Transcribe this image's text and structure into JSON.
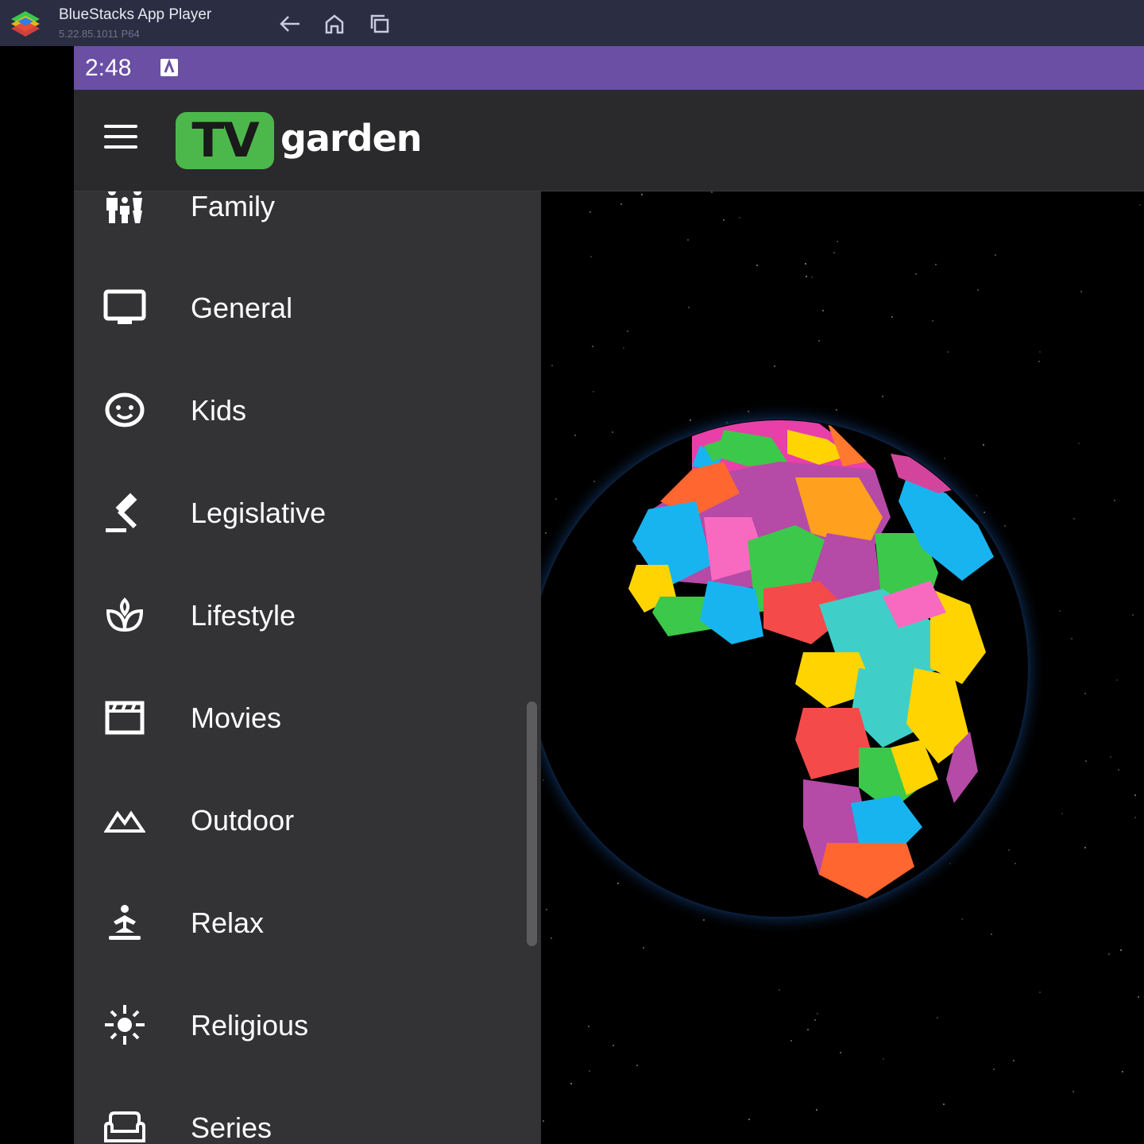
{
  "window": {
    "title": "BlueStacks App Player",
    "version": "5.22.85.1011  P64",
    "nav_icons": [
      "back-arrow-icon",
      "home-icon",
      "recent-apps-icon"
    ]
  },
  "status_bar": {
    "time": "2:48",
    "notification_icon": "app-notification-icon",
    "color": "#6a4fa5"
  },
  "app_bar": {
    "logo_badge": "TV",
    "logo_text": "garden",
    "logo_color": "#4cb84c",
    "menu_icon": "hamburger-menu-icon"
  },
  "drawer": {
    "items": [
      {
        "label": "Family",
        "icon": "family-icon"
      },
      {
        "label": "General",
        "icon": "monitor-icon"
      },
      {
        "label": "Kids",
        "icon": "baby-face-icon"
      },
      {
        "label": "Legislative",
        "icon": "gavel-icon"
      },
      {
        "label": "Lifestyle",
        "icon": "lotus-icon"
      },
      {
        "label": "Movies",
        "icon": "clapperboard-icon"
      },
      {
        "label": "Outdoor",
        "icon": "mountains-icon"
      },
      {
        "label": "Relax",
        "icon": "meditation-icon"
      },
      {
        "label": "Religious",
        "icon": "sun-rays-icon"
      },
      {
        "label": "Series",
        "icon": "sofa-icon"
      }
    ]
  },
  "map": {
    "view": "3D globe showing Africa, Europe and the Middle East with countries in random colors"
  }
}
